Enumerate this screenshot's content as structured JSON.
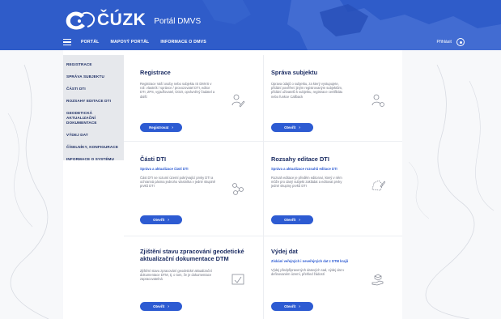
{
  "header": {
    "logo_text": "ČÚZK",
    "portal_title": "Portál DMVS",
    "nav": [
      "PORTÁL",
      "MAPOVÝ PORTÁL",
      "INFORMACE O DMVS"
    ],
    "login_label": "Přihlásit"
  },
  "sidebar": {
    "items": [
      "REGISTRACE",
      "SPRÁVA SUBJEKTU",
      "ČÁSTI DTI",
      "ROZSAHY EDITACE DTI",
      "GEODETICKÁ AKTUALIZAČNÍ DOKUMENTACE",
      "VÝDEJ DAT",
      "ČÍSELNÍKY, KONFIGURACE",
      "INFORMACE O SYSTÉMU"
    ]
  },
  "cards": {
    "registrace": {
      "title": "Registrace",
      "text": "Registrace Vaší osoby nebo subjektu IS DMVS v roli: vlastník / správce / provozovatel DTI, editor DTI, ZPS, vyjadřovatel, ÚOZI, oprávněný žadatel a další",
      "button": "Registrovat"
    },
    "sprava": {
      "title": "Správa subjektu",
      "text": "Úprava údajů o subjektu, za který vystupujete, přidání pověření jiným registrovaným subjektům, přidání uživatelů k subjektu, registrace certifikátu nebo funkce Callback",
      "button": "Otevřít"
    },
    "casti": {
      "title": "Části DTI",
      "subtitle": "Správa a aktualizace částí DTI",
      "text": "Část DTI se rozumí území pokrývající prvky DTI a ochranná pásma jednoho vlastníka v jedné skupině prvků DTI",
      "button": "Otevřít"
    },
    "rozsahy": {
      "title": "Rozsahy editace DTI",
      "subtitle": "Správa a aktualizace rozsahů editace DTI",
      "text": "Rozsah editace je předěm editorovi, který v něm může pro daný subjekt zakládat a editovat prvky jedné skupiny prvků DTI",
      "button": "Otevřít"
    },
    "zjisteni": {
      "title": "Zjištění stavu zpracování geodetické aktualizační dokumentace DTM",
      "text": "Zjištění stavu zpracování geodetické aktualizační dokumentace DTM, tj. o tom, že je dokumentace zapracovatelná",
      "button": "Otevřít"
    },
    "vydej": {
      "title": "Výdej dat",
      "subtitle": "Získání veřejných i neveřejných dat z DTM krajů",
      "text": "Výdej předpřipravených datových sad, výdej dat v definovaném území, přehled žádostí",
      "button": "Otevřít"
    }
  },
  "colors": {
    "header_blue": "#2f5cc9",
    "map_blue": "#3b67d1",
    "accent": "#2d5bd2",
    "title": "#1c2d63"
  }
}
